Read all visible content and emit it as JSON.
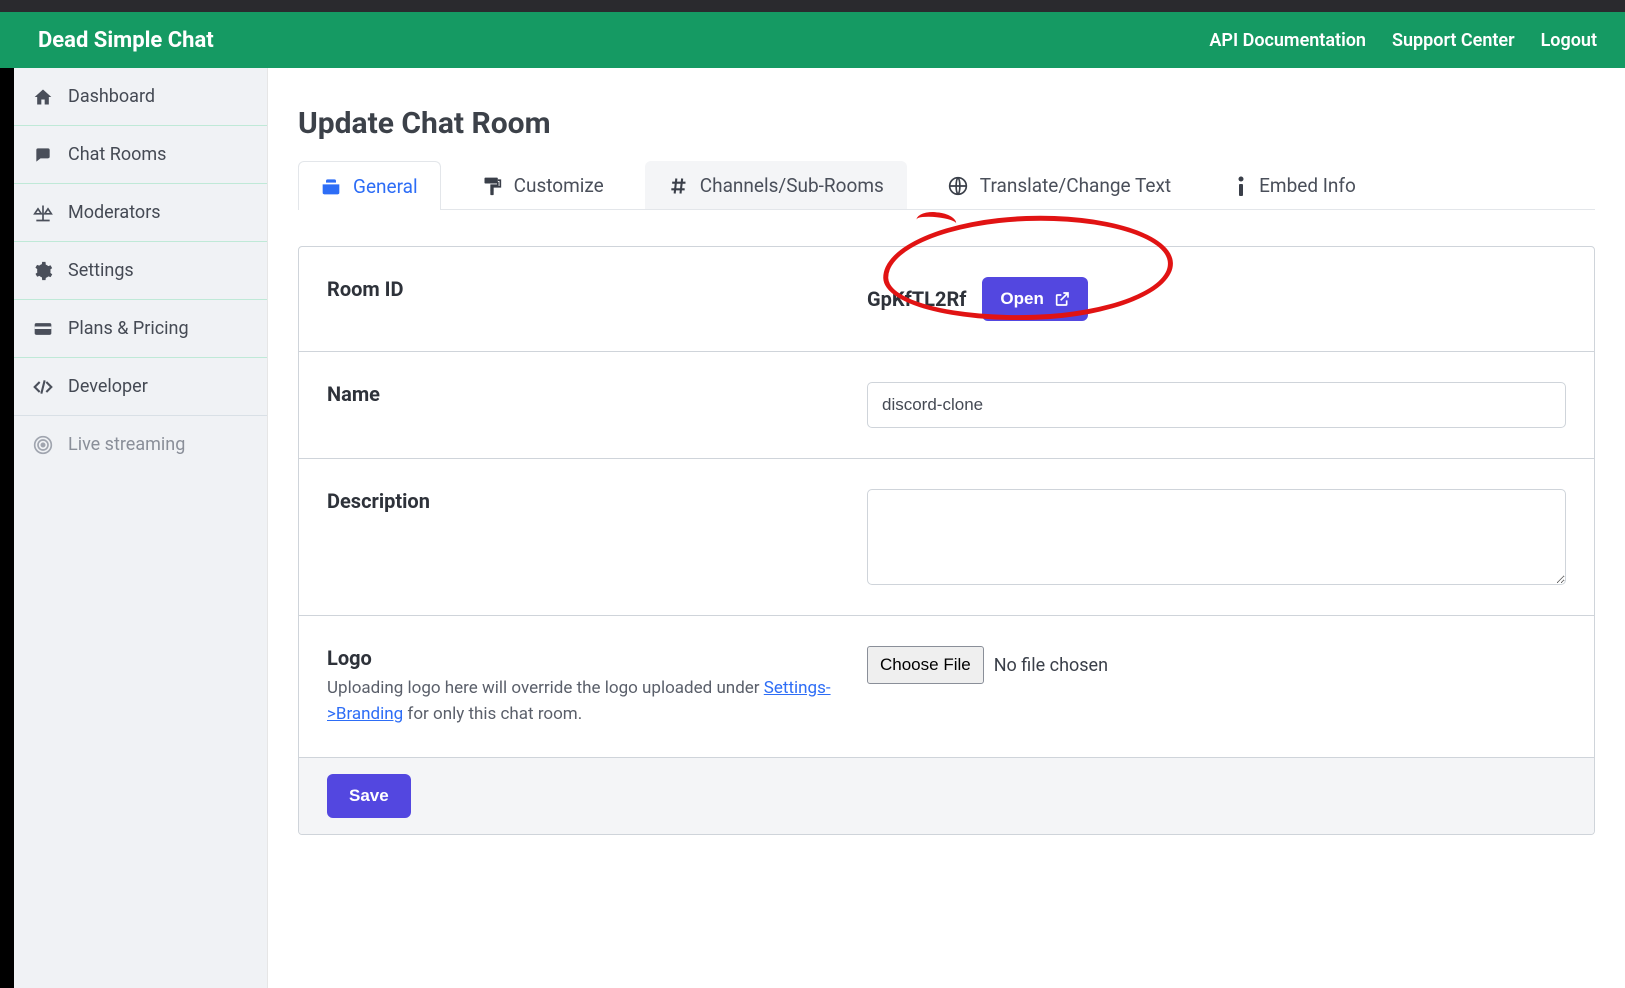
{
  "brand": "Dead Simple Chat",
  "top_links": {
    "api_docs": "API Documentation",
    "support": "Support Center",
    "logout": "Logout"
  },
  "sidebar": {
    "items": [
      {
        "label": "Dashboard"
      },
      {
        "label": "Chat Rooms"
      },
      {
        "label": "Moderators"
      },
      {
        "label": "Settings"
      },
      {
        "label": "Plans & Pricing"
      },
      {
        "label": "Developer"
      },
      {
        "label": "Live streaming"
      }
    ]
  },
  "page_title": "Update Chat Room",
  "tabs": {
    "general": "General",
    "customize": "Customize",
    "channels": "Channels/Sub-Rooms",
    "translate": "Translate/Change Text",
    "embed": "Embed Info"
  },
  "form": {
    "room_id_label": "Room ID",
    "room_id_value": "GpKfTL2Rf",
    "open_label": "Open",
    "name_label": "Name",
    "name_value": "discord-clone",
    "description_label": "Description",
    "description_value": "",
    "logo_label": "Logo",
    "logo_sub_pre": "Uploading logo here will override the logo uploaded under ",
    "logo_sub_link": "Settings->Branding",
    "logo_sub_post": " for only this chat room.",
    "choose_file": "Choose File",
    "no_file": "No file chosen",
    "save": "Save"
  }
}
